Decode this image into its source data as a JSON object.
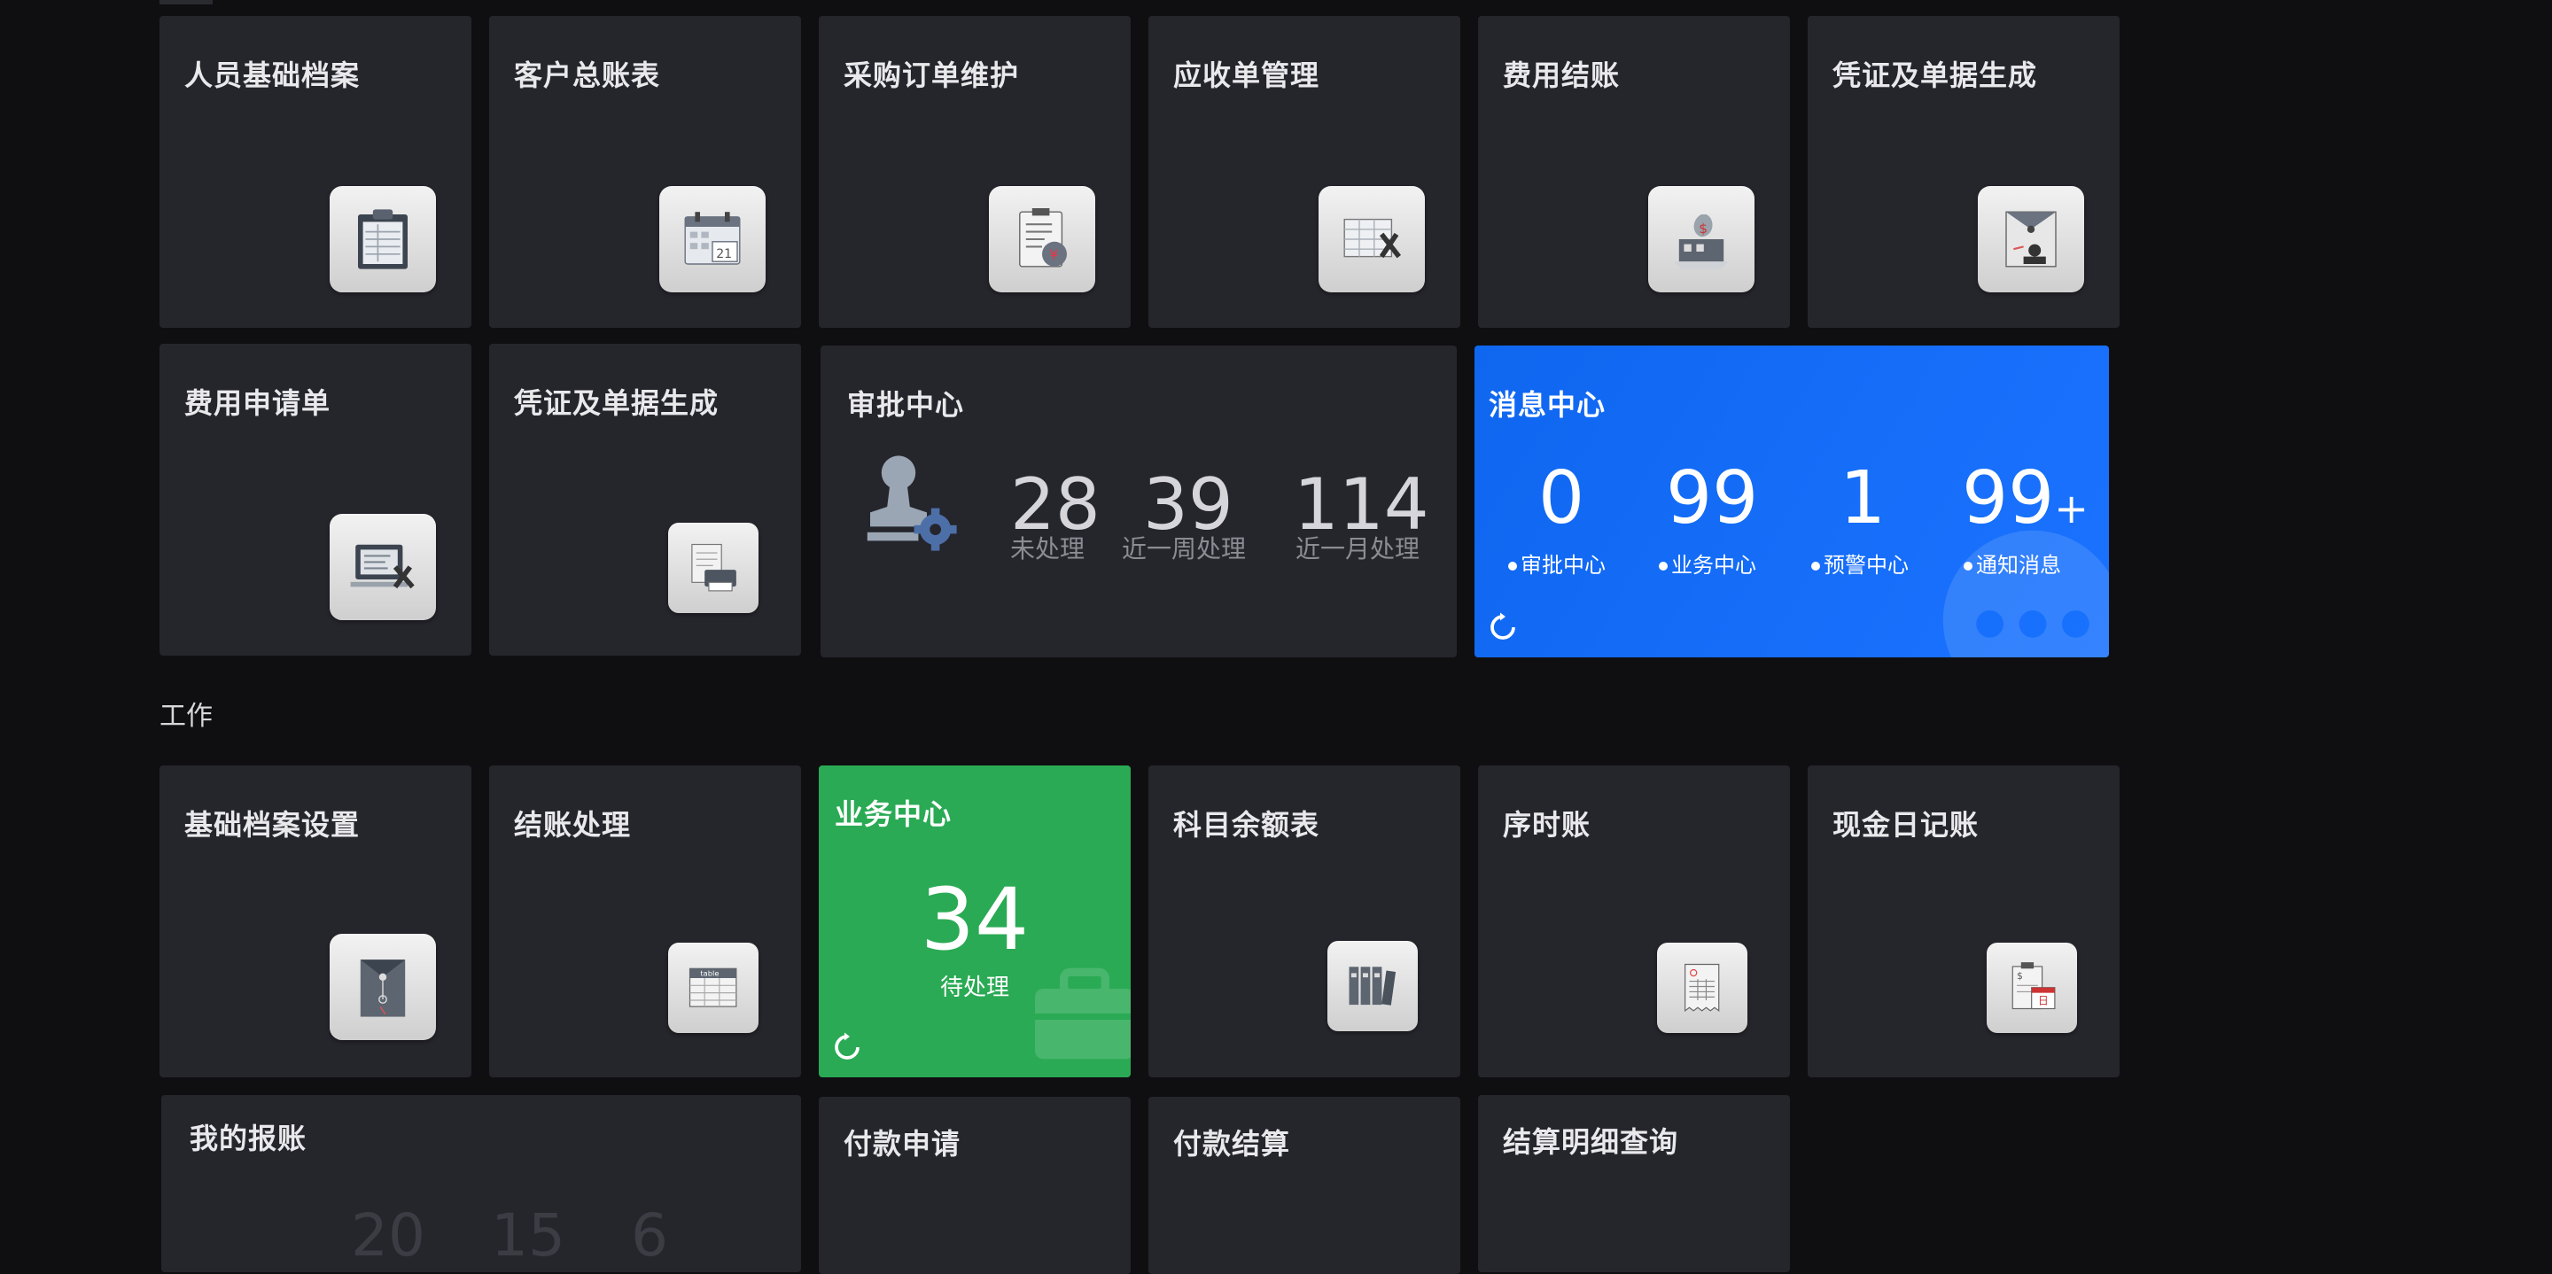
{
  "tiles": {
    "t1": "人员基础档案",
    "t2": "客户总账表",
    "t3": "采购订单维护",
    "t4": "应收单管理",
    "t5": "费用结账",
    "t6": "凭证及单据生成",
    "t7": "费用申请单",
    "t8": "凭证及单据生成",
    "t9": "基础档案设置",
    "t10": "结账处理",
    "t11": "科目余额表",
    "t12": "序时账",
    "t13": "现金日记账",
    "t14": "我的报账",
    "t15": "付款申请",
    "t16": "付款结算",
    "t17": "结算明细查询"
  },
  "approval": {
    "title": "审批中心",
    "stats": [
      {
        "value": "28",
        "label": "未处理"
      },
      {
        "value": "39",
        "label": "近一周处理"
      },
      {
        "value": "114",
        "label": "近一月处理"
      }
    ]
  },
  "messages": {
    "title": "消息中心",
    "stats": [
      {
        "value": "0",
        "label": "审批中心"
      },
      {
        "value": "99",
        "label": "业务中心"
      },
      {
        "value": "1",
        "label": "预警中心"
      },
      {
        "value": "99",
        "suffix": "+",
        "label": "通知消息"
      }
    ]
  },
  "section": {
    "work_label": "工作"
  },
  "business": {
    "title": "业务中心",
    "value": "34",
    "label": "待处理"
  },
  "reimburse": {
    "values": [
      "20",
      "15",
      "6"
    ]
  },
  "icons": {
    "t1": "clipboard-list-icon",
    "t2": "calendar-icon",
    "t3": "purchase-order-icon",
    "t4": "spreadsheet-tools-icon",
    "t5": "money-bag-icon",
    "t6": "envelope-stamp-icon",
    "t7": "computer-tools-icon",
    "t8": "printer-docs-icon",
    "t9": "file-envelope-icon",
    "t10": "table-icon",
    "t11": "binders-icon",
    "t12": "receipt-icon",
    "t13": "cash-journal-icon",
    "approval": "stamp-gear-icon",
    "refresh": "refresh-icon"
  },
  "colors": {
    "message_bg": "#1570f5",
    "business_bg": "#2aaa54",
    "tile_bg": "#25252c"
  }
}
